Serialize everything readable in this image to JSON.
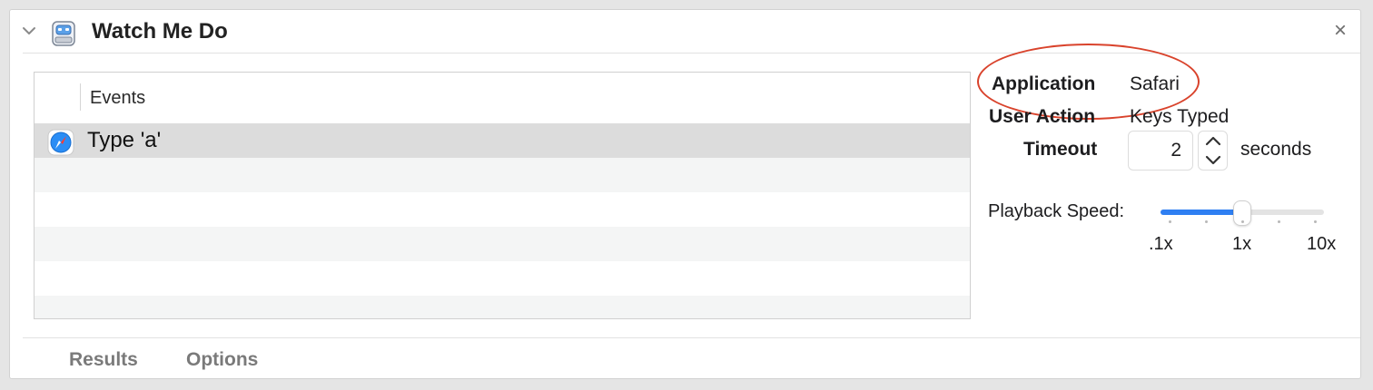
{
  "action": {
    "title": "Watch Me Do",
    "icon": "robot-icon",
    "close_label": "×"
  },
  "events_table": {
    "column_title": "Events",
    "rows": [
      {
        "label": "Type 'a'",
        "icon": "safari-icon",
        "selected": true
      }
    ]
  },
  "properties": {
    "application_label": "Application",
    "application_value": "Safari",
    "user_action_label": "User Action",
    "user_action_value": "Keys Typed",
    "timeout_label": "Timeout",
    "timeout_value": "2",
    "timeout_unit": "seconds"
  },
  "playback": {
    "label": "Playback Speed:",
    "tick_labels": [
      ".1x",
      "1x",
      "10x"
    ],
    "tick_count": 5,
    "position": 0.5
  },
  "footer": {
    "tabs": [
      "Results",
      "Options"
    ]
  },
  "colors": {
    "accent": "#2f7ff2",
    "highlight": "#d9432c"
  }
}
